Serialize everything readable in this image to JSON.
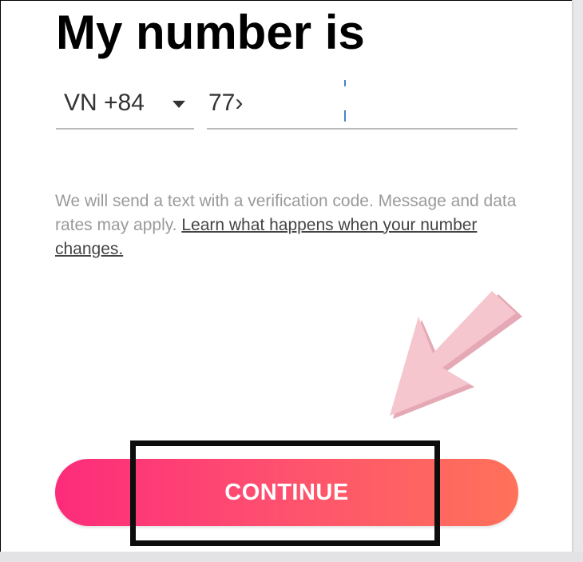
{
  "header": {
    "title": "My number is"
  },
  "phone_form": {
    "country_code": "VN +84",
    "phone_value": "77›"
  },
  "disclaimer": {
    "text": "We will send a text with a verification code. Message and data rates may apply. ",
    "link": "Learn what happens when your number changes."
  },
  "actions": {
    "continue_label": "CONTINUE"
  },
  "colors": {
    "button_gradient_start": "#fd2b7b",
    "button_gradient_end": "#ff7259",
    "annotation_arrow": "#f6c3cb",
    "highlight_border": "#0d0d0d"
  },
  "icons": {
    "caret": "caret-down-icon",
    "annotation": "arrow-pointer-icon"
  }
}
